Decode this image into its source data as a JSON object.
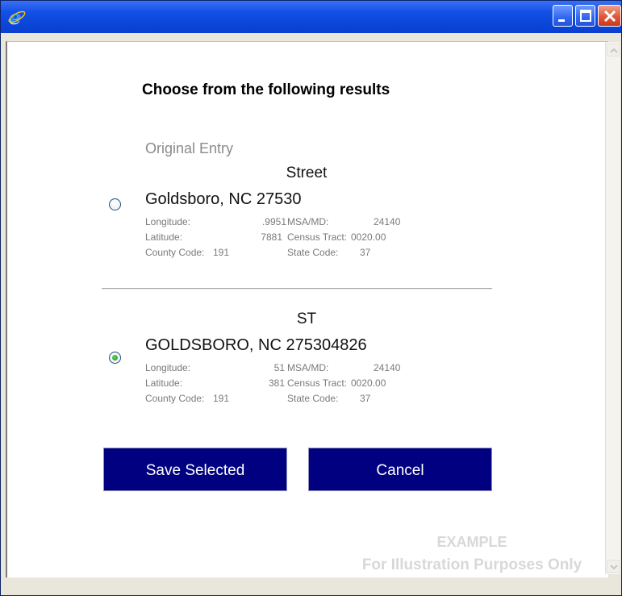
{
  "window": {
    "icon": "ie-icon"
  },
  "dialog": {
    "heading": "Choose from the following results",
    "original_entry_label": "Original Entry",
    "results": [
      {
        "street": "Street",
        "city": "Goldsboro, NC 27530",
        "selected": false,
        "longitude_label": "Longitude:",
        "longitude": ".9951",
        "latitude_label": "Latitude:",
        "latitude": "7881",
        "county_label": "County Code:",
        "county": "191",
        "msa_label": "MSA/MD:",
        "msa": "24140",
        "tract_label": "Census Tract:",
        "tract": "0020.00",
        "state_label": "State Code:",
        "state": "37"
      },
      {
        "street": "ST",
        "city": "GOLDSBORO, NC 275304826",
        "selected": true,
        "longitude_label": "Longitude:",
        "longitude": "51",
        "latitude_label": "Latitude:",
        "latitude": "381",
        "county_label": "County Code:",
        "county": "191",
        "msa_label": "MSA/MD:",
        "msa": "24140",
        "tract_label": "Census Tract:",
        "tract": "0020.00",
        "state_label": "State Code:",
        "state": "37"
      }
    ],
    "save_label": "Save Selected",
    "cancel_label": "Cancel"
  },
  "watermark": {
    "line1": "EXAMPLE",
    "line2": "For Illustration Purposes Only"
  },
  "colors": {
    "titlebar": "#0b46d8",
    "button_bg": "#000080",
    "button_text": "#ffffff",
    "detail_text": "#7a7a7a",
    "radio_checked": "#1f8f1f"
  }
}
